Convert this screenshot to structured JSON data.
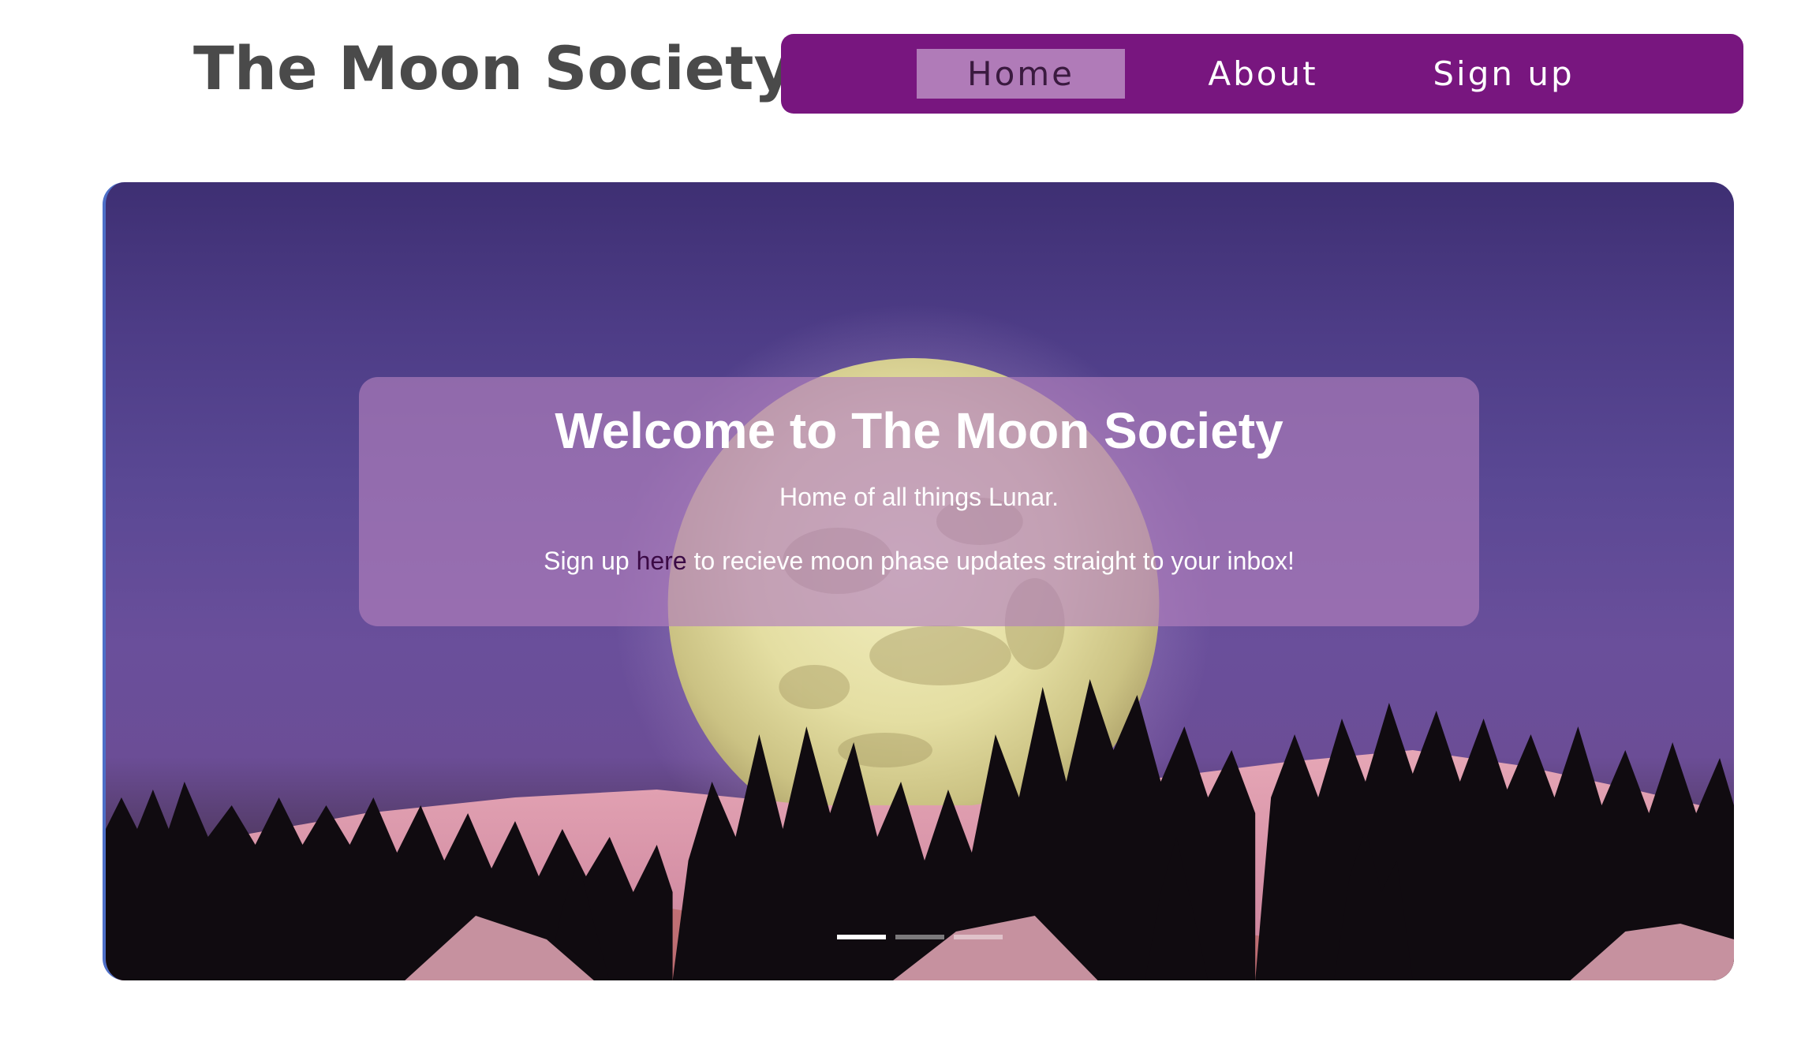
{
  "header": {
    "brand": "The Moon Society"
  },
  "nav": {
    "items": [
      {
        "label": "Home",
        "active": true
      },
      {
        "label": "About",
        "active": false
      },
      {
        "label": "Sign up",
        "active": false
      }
    ]
  },
  "hero": {
    "title": "Welcome to The Moon Society",
    "subtitle": "Home of all things Lunar.",
    "signup_prefix": "Sign up ",
    "signup_link": "here",
    "signup_suffix": " to recieve moon phase updates straight to your inbox!",
    "image_alt_icon": "moonrise-over-snowy-forest-image",
    "slides": 3,
    "active_slide": 1
  },
  "colors": {
    "nav_bg": "#78167f",
    "nav_active_bg": "#b07bb8",
    "brand_text": "#4a4a4a",
    "caption_bg": "rgba(178,128,188,0.66)",
    "link": "#3b0a45"
  }
}
